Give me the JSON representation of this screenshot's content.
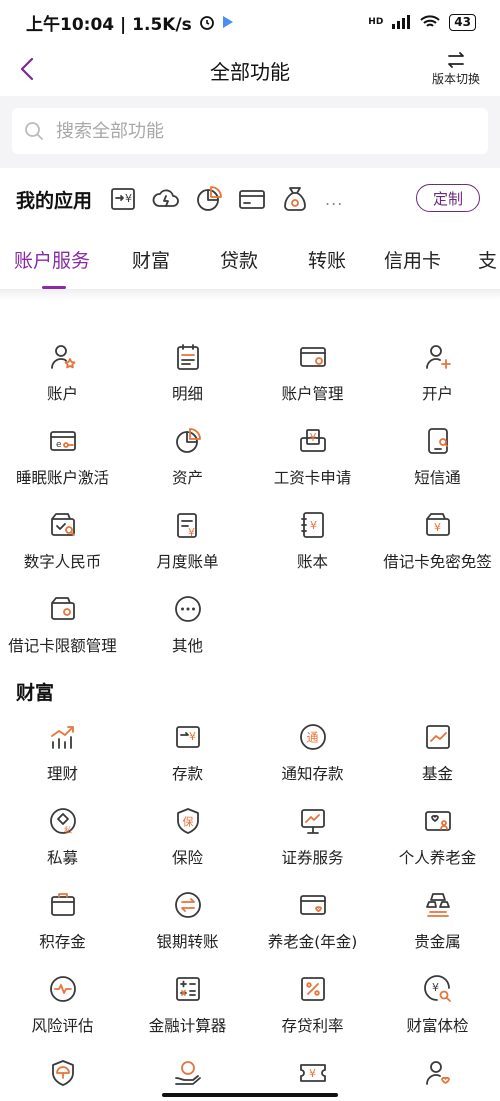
{
  "status": {
    "time_speed": "上午10:04 | 1.5K/s",
    "battery": "43",
    "network": "HD"
  },
  "header": {
    "title": "全部功能",
    "version_label": "版本切换"
  },
  "search": {
    "placeholder": "搜索全部功能"
  },
  "my_apps": {
    "label": "我的应用",
    "more": "...",
    "customize_label": "定制",
    "icons": [
      "transfer-yuan-icon",
      "cloud-lightning-icon",
      "pie-chart-icon",
      "card-icon",
      "money-bag-icon"
    ]
  },
  "tabs": [
    {
      "label": "账户服务",
      "active": true
    },
    {
      "label": "财富",
      "active": false
    },
    {
      "label": "贷款",
      "active": false
    },
    {
      "label": "转账",
      "active": false
    },
    {
      "label": "信用卡",
      "active": false
    },
    {
      "label": "支",
      "active": false
    }
  ],
  "sections": [
    {
      "title": "",
      "items": [
        {
          "label": "账户",
          "icon": "user-star-icon"
        },
        {
          "label": "明细",
          "icon": "list-doc-icon"
        },
        {
          "label": "账户管理",
          "icon": "card-settings-icon"
        },
        {
          "label": "开户",
          "icon": "user-plus-icon"
        },
        {
          "label": "睡眠账户激活",
          "icon": "card-key-icon"
        },
        {
          "label": "资产",
          "icon": "pie-chart-icon"
        },
        {
          "label": "工资卡申请",
          "icon": "salary-card-icon"
        },
        {
          "label": "短信通",
          "icon": "phone-message-icon"
        },
        {
          "label": "数字人民币",
          "icon": "digital-wallet-icon"
        },
        {
          "label": "月度账单",
          "icon": "monthly-bill-icon"
        },
        {
          "label": "账本",
          "icon": "ledger-icon"
        },
        {
          "label": "借记卡免密免签",
          "icon": "wallet-yuan-icon"
        },
        {
          "label": "借记卡限额管理",
          "icon": "wallet-limit-icon"
        },
        {
          "label": "其他",
          "icon": "more-circle-icon"
        }
      ]
    },
    {
      "title": "财富",
      "items": [
        {
          "label": "理财",
          "icon": "growth-bars-icon"
        },
        {
          "label": "存款",
          "icon": "deposit-icon"
        },
        {
          "label": "通知存款",
          "icon": "notice-deposit-icon"
        },
        {
          "label": "基金",
          "icon": "fund-chart-icon"
        },
        {
          "label": "私募",
          "icon": "private-diamond-icon"
        },
        {
          "label": "保险",
          "icon": "insurance-shield-icon"
        },
        {
          "label": "证券服务",
          "icon": "securities-monitor-icon"
        },
        {
          "label": "个人养老金",
          "icon": "pension-card-icon"
        },
        {
          "label": "积存金",
          "icon": "gold-box-icon"
        },
        {
          "label": "银期转账",
          "icon": "swap-circle-icon"
        },
        {
          "label": "养老金(年金)",
          "icon": "annuity-card-icon"
        },
        {
          "label": "贵金属",
          "icon": "gold-bars-icon"
        },
        {
          "label": "风险评估",
          "icon": "risk-pulse-icon"
        },
        {
          "label": "金融计算器",
          "icon": "calculator-icon"
        },
        {
          "label": "存贷利率",
          "icon": "rate-percent-icon"
        },
        {
          "label": "财富体检",
          "icon": "wealth-check-icon"
        },
        {
          "label": "",
          "icon": "umbrella-shield-icon"
        },
        {
          "label": "",
          "icon": "hand-coin-icon"
        },
        {
          "label": "",
          "icon": "ticket-yuan-icon"
        },
        {
          "label": "",
          "icon": "user-heart-icon"
        }
      ]
    }
  ]
}
